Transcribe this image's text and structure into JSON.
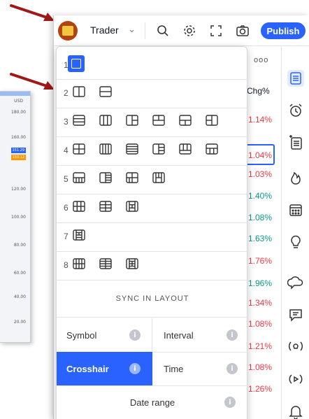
{
  "background_chart": {
    "currency": "USD",
    "axis_labels": [
      "180.00",
      "160.00",
      "120.00",
      "100.00",
      "80.00",
      "60.00",
      "40.00",
      "20.00"
    ],
    "price_tags": [
      "151.29",
      "150.12"
    ]
  },
  "toolbar": {
    "layout_name": "Trader",
    "publish_label": "Publish"
  },
  "watchlist": {
    "column_header": "Chg%",
    "more_label": "ooo",
    "values": [
      {
        "text": "1.14%",
        "color": "red"
      },
      {
        "text": "1.04%",
        "color": "red"
      },
      {
        "text": "1.03%",
        "color": "red"
      },
      {
        "text": "1.40%",
        "color": "green"
      },
      {
        "text": "1.08%",
        "color": "green"
      },
      {
        "text": "1.63%",
        "color": "green"
      },
      {
        "text": "1.76%",
        "color": "red"
      },
      {
        "text": "1.96%",
        "color": "green"
      },
      {
        "text": "1.34%",
        "color": "red"
      },
      {
        "text": "1.08%",
        "color": "red"
      },
      {
        "text": "1.21%",
        "color": "red"
      },
      {
        "text": "1.08%",
        "color": "red"
      },
      {
        "text": "1.26%",
        "color": "red"
      }
    ]
  },
  "layout_menu": {
    "rows": [
      {
        "number": "1",
        "layouts": [
          "single"
        ]
      },
      {
        "number": "2",
        "layouts": [
          "2-vertical",
          "2-horizontal"
        ]
      },
      {
        "number": "3",
        "layouts": [
          "3-horizontal",
          "3-vertical",
          "1-left-2-right",
          "2-top-1-bottom",
          "1-top-2-bottom",
          "2-left-1-right"
        ]
      },
      {
        "number": "4",
        "layouts": [
          "2x2",
          "4-vertical",
          "4-horizontal",
          "1-left-3-right",
          "3-top-1-bottom",
          "1-top-3-bottom"
        ]
      },
      {
        "number": "5",
        "layouts": [
          "5-a",
          "5-b",
          "5-c",
          "5-d"
        ]
      },
      {
        "number": "6",
        "layouts": [
          "3x2",
          "2x3",
          "6-c"
        ]
      },
      {
        "number": "7",
        "layouts": [
          "7-a"
        ]
      },
      {
        "number": "8",
        "layouts": [
          "4x2",
          "2x4",
          "8-c"
        ]
      }
    ],
    "sync_title": "SYNC IN LAYOUT",
    "sync_options": [
      {
        "label": "Symbol",
        "active": false
      },
      {
        "label": "Interval",
        "active": false
      },
      {
        "label": "Crosshair",
        "active": true
      },
      {
        "label": "Time",
        "active": false
      },
      {
        "label": "Date range",
        "active": false
      }
    ],
    "info_glyph": "i"
  },
  "colors": {
    "accent": "#2962ff",
    "annotation_arrow": "#a01818",
    "negative": "#f23645",
    "positive": "#089981"
  }
}
